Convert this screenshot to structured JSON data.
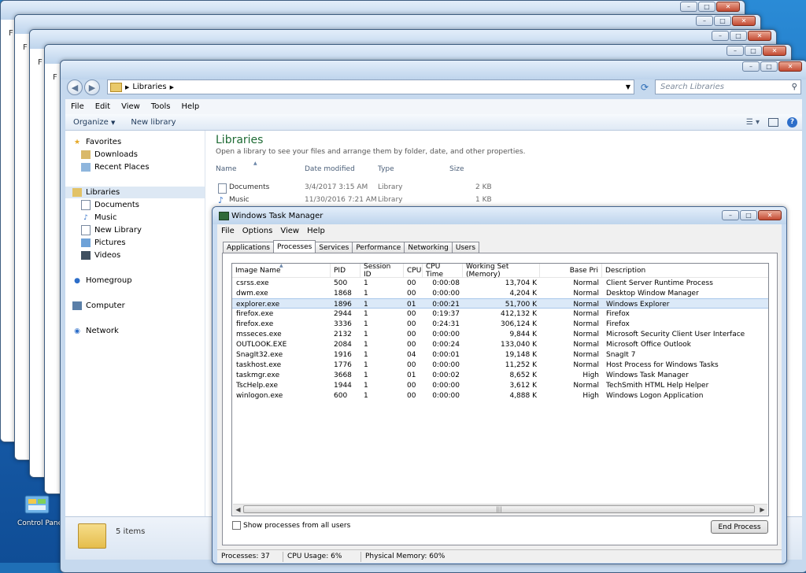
{
  "explorer": {
    "address_segments": [
      "Libraries"
    ],
    "search_placeholder": "Search Libraries",
    "menu": [
      "File",
      "Edit",
      "View",
      "Tools",
      "Help"
    ],
    "commands": {
      "organize": "Organize",
      "new_library": "New library"
    },
    "nav": {
      "favorites": "Favorites",
      "downloads": "Downloads",
      "recent_places": "Recent Places",
      "libraries": "Libraries",
      "documents": "Documents",
      "music": "Music",
      "new_library": "New Library",
      "pictures": "Pictures",
      "videos": "Videos",
      "homegroup": "Homegroup",
      "computer": "Computer",
      "network": "Network"
    },
    "title": "Libraries",
    "subtitle": "Open a library to see your files and arrange them by folder, date, and other properties.",
    "columns": {
      "name": "Name",
      "date": "Date modified",
      "type": "Type",
      "size": "Size"
    },
    "files": [
      {
        "name": "Documents",
        "date": "3/4/2017 3:15 AM",
        "type": "Library",
        "size": "2 KB"
      },
      {
        "name": "Music",
        "date": "11/30/2016 7:21 AM",
        "type": "Library",
        "size": "1 KB"
      }
    ],
    "item_count": "5 items"
  },
  "taskmgr": {
    "title": "Windows Task Manager",
    "menu": [
      "File",
      "Options",
      "View",
      "Help"
    ],
    "tabs": [
      "Applications",
      "Processes",
      "Services",
      "Performance",
      "Networking",
      "Users"
    ],
    "active_tab": "Processes",
    "columns": {
      "image": "Image Name",
      "pid": "PID",
      "session": "Session ID",
      "cpu": "CPU",
      "cputime": "CPU Time",
      "ws": "Working Set (Memory)",
      "basepri": "Base Pri",
      "desc": "Description"
    },
    "processes": [
      {
        "image": "csrss.exe",
        "pid": "500",
        "session": "1",
        "cpu": "00",
        "cputime": "0:00:08",
        "ws": "13,704 K",
        "basepri": "Normal",
        "desc": "Client Server Runtime Process"
      },
      {
        "image": "dwm.exe",
        "pid": "1868",
        "session": "1",
        "cpu": "00",
        "cputime": "0:00:00",
        "ws": "4,204 K",
        "basepri": "Normal",
        "desc": "Desktop Window Manager"
      },
      {
        "image": "explorer.exe",
        "pid": "1896",
        "session": "1",
        "cpu": "01",
        "cputime": "0:00:21",
        "ws": "51,700 K",
        "basepri": "Normal",
        "desc": "Windows Explorer"
      },
      {
        "image": "firefox.exe",
        "pid": "2944",
        "session": "1",
        "cpu": "00",
        "cputime": "0:19:37",
        "ws": "412,132 K",
        "basepri": "Normal",
        "desc": "Firefox"
      },
      {
        "image": "firefox.exe",
        "pid": "3336",
        "session": "1",
        "cpu": "00",
        "cputime": "0:24:31",
        "ws": "306,124 K",
        "basepri": "Normal",
        "desc": "Firefox"
      },
      {
        "image": "msseces.exe",
        "pid": "2132",
        "session": "1",
        "cpu": "00",
        "cputime": "0:00:00",
        "ws": "9,844 K",
        "basepri": "Normal",
        "desc": "Microsoft Security Client User Interface"
      },
      {
        "image": "OUTLOOK.EXE",
        "pid": "2084",
        "session": "1",
        "cpu": "00",
        "cputime": "0:00:24",
        "ws": "133,040 K",
        "basepri": "Normal",
        "desc": "Microsoft Office Outlook"
      },
      {
        "image": "SnagIt32.exe",
        "pid": "1916",
        "session": "1",
        "cpu": "04",
        "cputime": "0:00:01",
        "ws": "19,148 K",
        "basepri": "Normal",
        "desc": "SnagIt 7"
      },
      {
        "image": "taskhost.exe",
        "pid": "1776",
        "session": "1",
        "cpu": "00",
        "cputime": "0:00:00",
        "ws": "11,252 K",
        "basepri": "Normal",
        "desc": "Host Process for Windows Tasks"
      },
      {
        "image": "taskmgr.exe",
        "pid": "3668",
        "session": "1",
        "cpu": "01",
        "cputime": "0:00:02",
        "ws": "8,652 K",
        "basepri": "High",
        "desc": "Windows Task Manager"
      },
      {
        "image": "TscHelp.exe",
        "pid": "1944",
        "session": "1",
        "cpu": "00",
        "cputime": "0:00:00",
        "ws": "3,612 K",
        "basepri": "Normal",
        "desc": "TechSmith HTML Help Helper"
      },
      {
        "image": "winlogon.exe",
        "pid": "600",
        "session": "1",
        "cpu": "00",
        "cputime": "0:00:00",
        "ws": "4,888 K",
        "basepri": "High",
        "desc": "Windows Logon Application"
      }
    ],
    "selected_index": 2,
    "show_all_label": "Show processes from all users",
    "end_process": "End Process",
    "status": {
      "processes": "Processes: 37",
      "cpu": "CPU Usage: 6%",
      "memory": "Physical Memory: 60%"
    }
  },
  "desktop": {
    "control_panel_label": "Control Panel"
  }
}
